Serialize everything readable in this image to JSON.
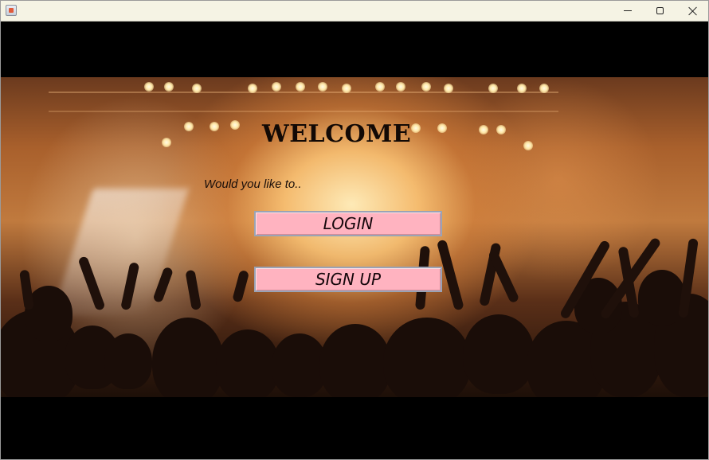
{
  "window": {
    "controls": {
      "minimize_icon": "minimize-icon",
      "maximize_icon": "maximize-icon",
      "close_icon": "close-icon"
    }
  },
  "welcome": {
    "title": "WELCOME",
    "prompt": "Would you like to..",
    "login_label": "LOGIN",
    "signup_label": "SIGN UP"
  },
  "colors": {
    "letterbox": "#000000",
    "button_fill": "#ffb3c0",
    "button_border": "#9aa3b5",
    "text_dark": "#120905",
    "titlebar": "#f5f3e4"
  }
}
